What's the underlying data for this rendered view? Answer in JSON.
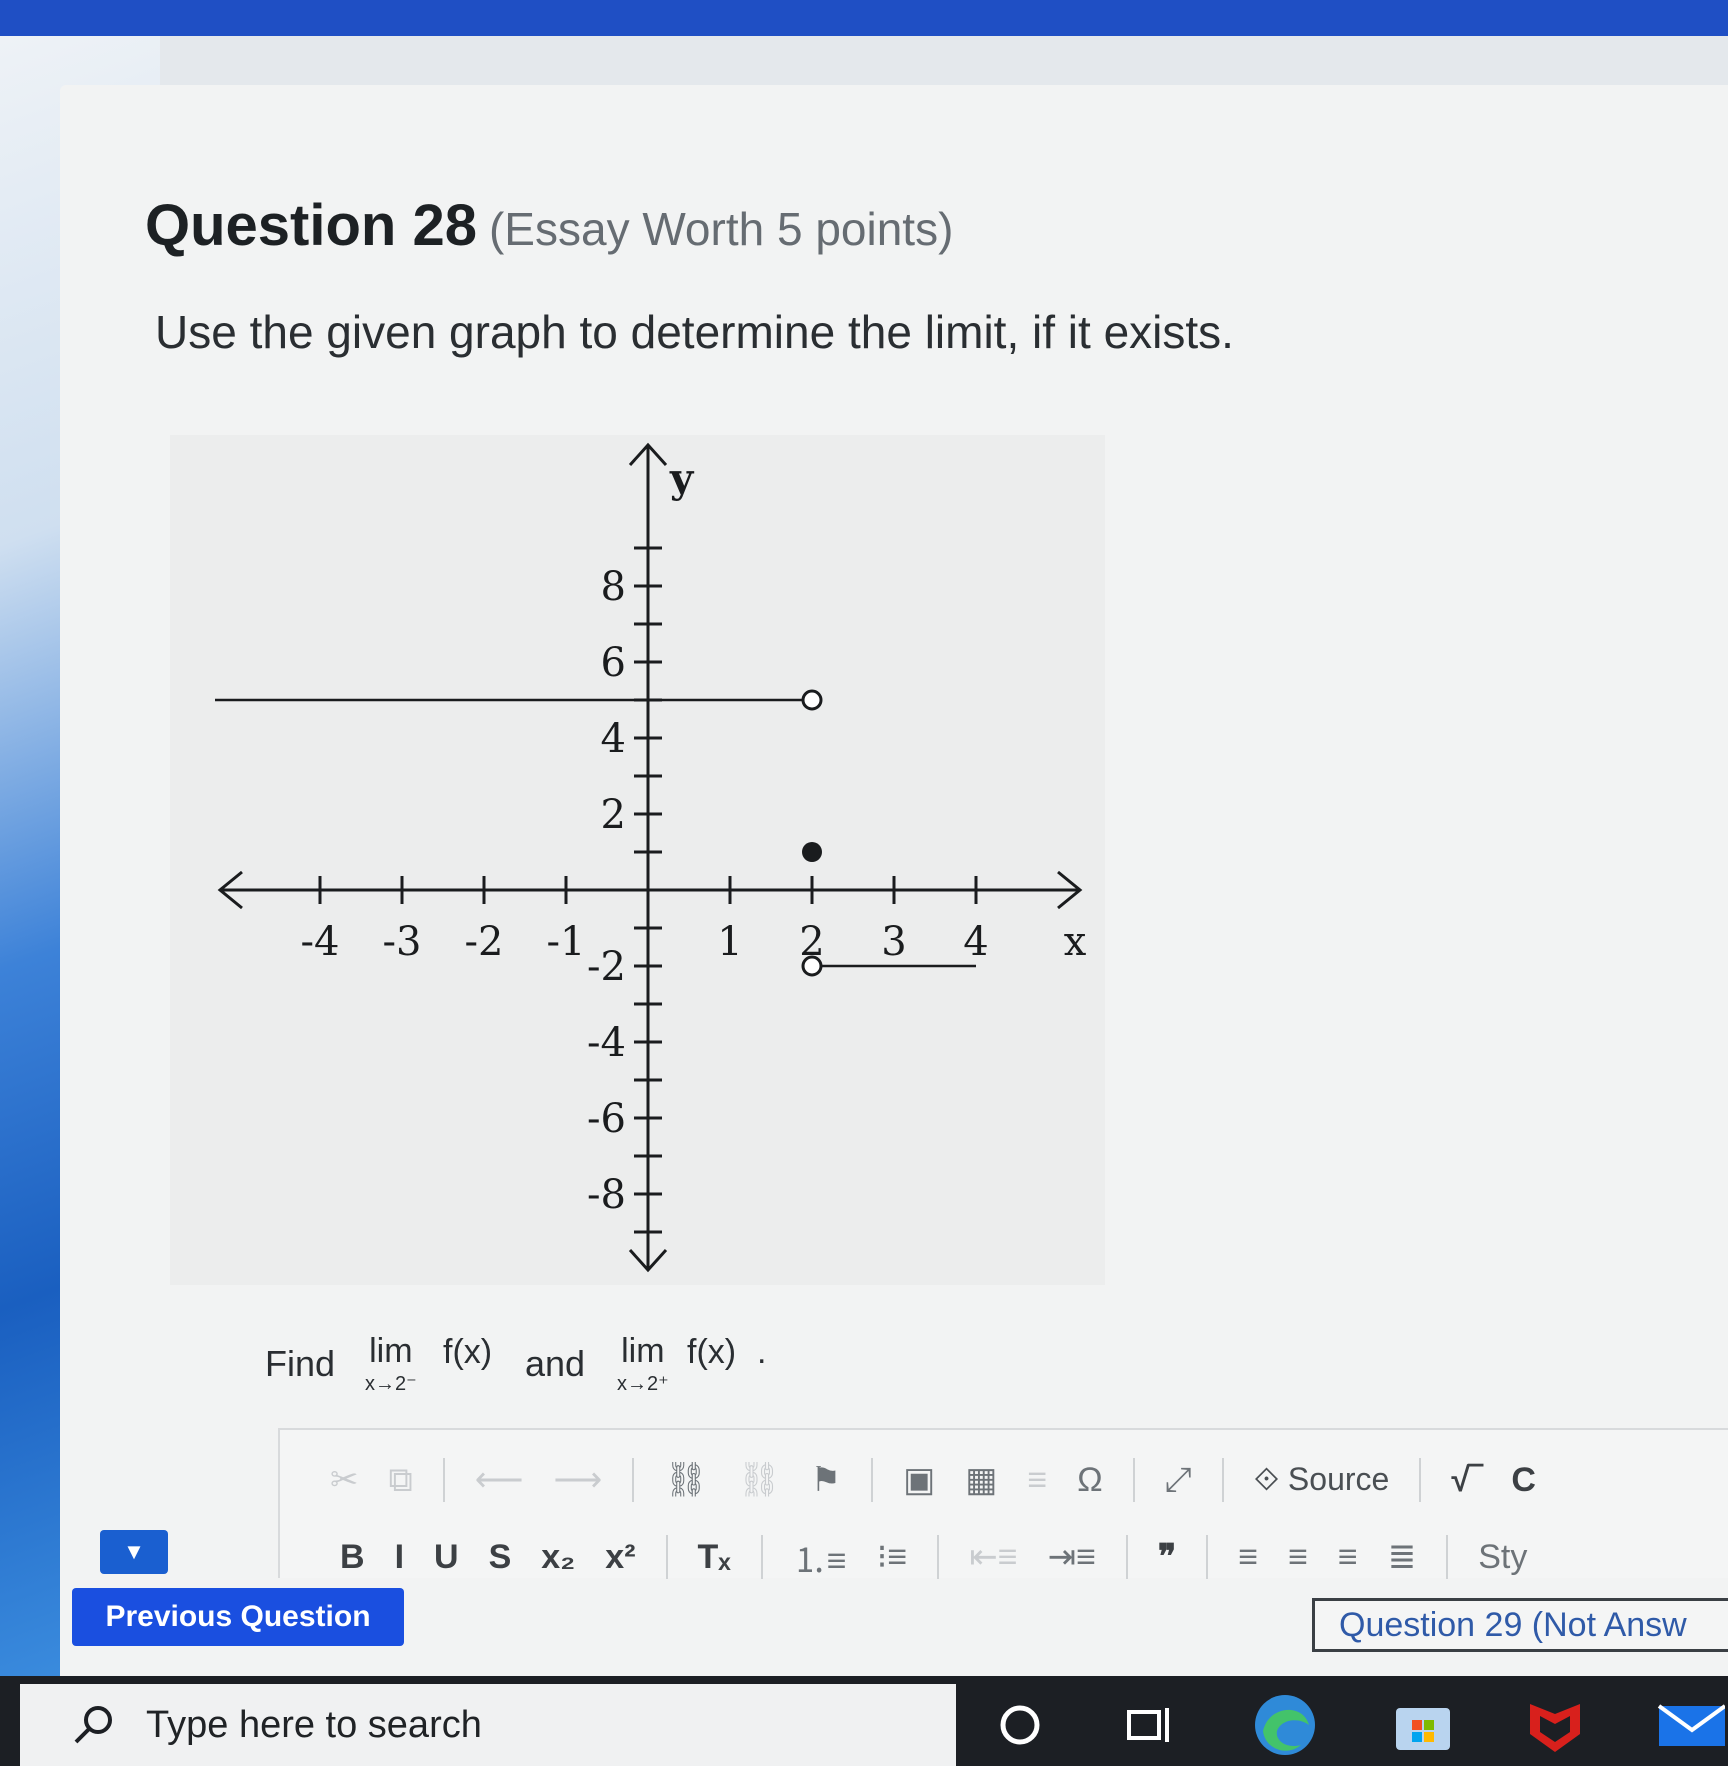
{
  "question": {
    "title": "Question 28",
    "meta": "(Essay Worth 5 points)",
    "prompt": "Use the given graph to determine the limit, if it exists."
  },
  "graph": {
    "y_axis_label": "y",
    "x_axis_label": "x",
    "x_ticks": [
      "-4",
      "-3",
      "-2",
      "-1",
      "1",
      "2",
      "3",
      "4"
    ],
    "y_ticks": [
      "8",
      "6",
      "4",
      "2",
      "-2",
      "-4",
      "-6",
      "-8"
    ],
    "xlim": [
      -4,
      4
    ],
    "ylim": [
      -8,
      8
    ],
    "pieces": [
      {
        "from_x": -5,
        "to_x": 2,
        "y": 5,
        "end": "open"
      },
      {
        "from_x": 2,
        "to_x": 4,
        "y": -2,
        "start": "open"
      }
    ],
    "points": [
      {
        "x": 2,
        "y": 1,
        "style": "filled"
      }
    ]
  },
  "find": {
    "find_word": "Find",
    "lim_word": "lim",
    "left_sub": "x→2⁻",
    "fx": "f(x)",
    "and_word": "and",
    "right_sub": "x→2⁺",
    "end": "."
  },
  "toolbar1": [
    {
      "name": "cut-icon",
      "glyph": "✂",
      "disabled": true
    },
    {
      "name": "copy-icon",
      "glyph": "⧉",
      "disabled": true
    },
    {
      "sep": true
    },
    {
      "name": "undo-icon",
      "glyph": "⟵",
      "disabled": true
    },
    {
      "name": "redo-icon",
      "glyph": "⟶",
      "disabled": true
    },
    {
      "sep": true
    },
    {
      "name": "link-icon",
      "glyph": "⛓",
      "disabled": false
    },
    {
      "name": "unlink-icon",
      "glyph": "⛓",
      "disabled": true
    },
    {
      "name": "anchor-flag-icon",
      "glyph": "⚑",
      "disabled": false
    },
    {
      "sep": true
    },
    {
      "name": "image-icon",
      "glyph": "▣",
      "disabled": false
    },
    {
      "name": "table-icon",
      "glyph": "▦",
      "disabled": false
    },
    {
      "name": "horizontal-line-icon",
      "glyph": "≡",
      "disabled": true
    },
    {
      "name": "special-char-icon",
      "glyph": "Ω",
      "disabled": false
    },
    {
      "sep": true
    },
    {
      "name": "maximize-icon",
      "glyph": "⤢",
      "disabled": false
    },
    {
      "sep": true
    },
    {
      "name": "source-button",
      "glyph": "⟐ Source",
      "disabled": false,
      "source": true
    },
    {
      "sep": true
    },
    {
      "name": "math-icon",
      "glyph": "√‾",
      "disabled": false,
      "bold": true
    },
    {
      "name": "chemistry-icon",
      "glyph": "C",
      "disabled": false,
      "bold": true
    }
  ],
  "toolbar2": [
    {
      "name": "bold-button",
      "glyph": "B",
      "bold": true
    },
    {
      "name": "italic-button",
      "glyph": "I",
      "bold": true
    },
    {
      "name": "underline-button",
      "glyph": "U",
      "bold": true
    },
    {
      "name": "strikethrough-button",
      "glyph": "S",
      "bold": true
    },
    {
      "name": "subscript-button",
      "glyph": "x₂",
      "bold": true
    },
    {
      "name": "superscript-button",
      "glyph": "x²",
      "bold": true
    },
    {
      "sep": true
    },
    {
      "name": "remove-format-button",
      "glyph": "Tₓ",
      "bold": true
    },
    {
      "sep": true
    },
    {
      "name": "numbered-list-icon",
      "glyph": "⒈≡"
    },
    {
      "name": "bulleted-list-icon",
      "glyph": "⁝≡"
    },
    {
      "sep": true
    },
    {
      "name": "outdent-icon",
      "glyph": "⇤≡",
      "disabled": true
    },
    {
      "name": "indent-icon",
      "glyph": "⇥≡"
    },
    {
      "sep": true
    },
    {
      "name": "blockquote-icon",
      "glyph": "❞",
      "bold": true
    },
    {
      "sep": true
    },
    {
      "name": "align-left-icon",
      "glyph": "≡"
    },
    {
      "name": "align-center-icon",
      "glyph": "≡"
    },
    {
      "name": "align-right-icon",
      "glyph": "≡"
    },
    {
      "name": "justify-icon",
      "glyph": "≣"
    },
    {
      "sep": true
    },
    {
      "name": "styles-dropdown",
      "glyph": "Sty"
    }
  ],
  "nav": {
    "collapse_glyph": "▼",
    "previous_label": "Previous Question",
    "next_label": "Question 29 (Not Answ"
  },
  "taskbar": {
    "search_placeholder": "Type here to search",
    "icons": [
      "cortana-icon",
      "task-view-icon",
      "edge-icon",
      "store-icon",
      "mcafee-icon",
      "mail-icon"
    ]
  },
  "colors": {
    "accent_blue": "#1a4fe0",
    "title_text": "#1d2124",
    "link_blue": "#2f5aa8",
    "taskbar_bg": "#1c1f24"
  }
}
